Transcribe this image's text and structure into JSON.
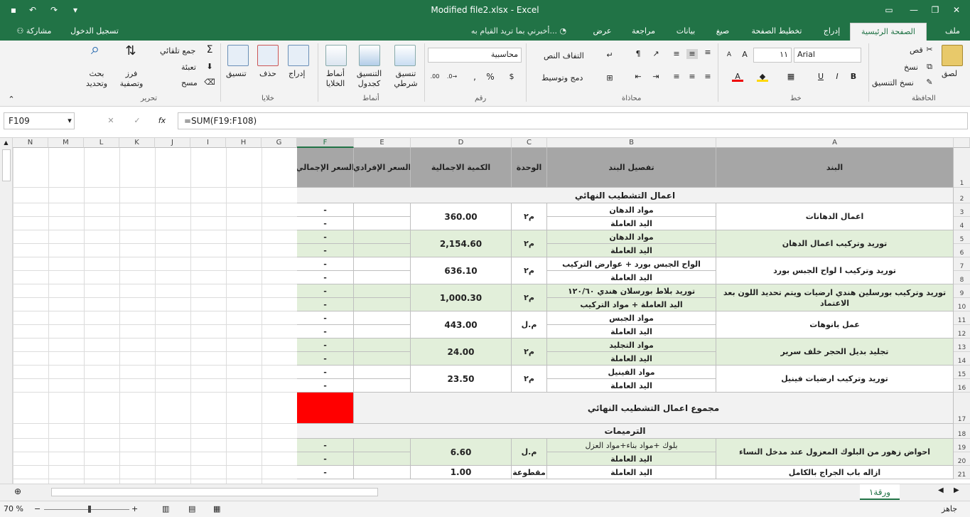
{
  "app": {
    "title": "Modified file2.xlsx - Excel",
    "signin": "تسجيل الدخول",
    "share": "مشاركة",
    "tell_me": "أخبرني بما تريد القيام به..."
  },
  "tabs": [
    "ملف",
    "الصفحة الرئيسية",
    "إدراج",
    "تخطيط الصفحة",
    "صيغ",
    "بيانات",
    "مراجعة",
    "عرض"
  ],
  "ribbon": {
    "clipboard": {
      "label": "الحافظة",
      "paste": "لصق",
      "cut": "قص",
      "copy": "نسخ",
      "format_painter": "نسخ التنسيق"
    },
    "font": {
      "label": "خط",
      "name": "Arial",
      "size": "١١",
      "bold": "B",
      "italic": "I",
      "underline": "U"
    },
    "alignment": {
      "label": "محاذاة",
      "wrap": "التفاف النص",
      "merge": "دمج وتوسيط"
    },
    "number": {
      "label": "رقم",
      "format": "محاسبية",
      "percent": "%",
      "comma": ","
    },
    "styles": {
      "label": "أنماط",
      "conditional": "تنسيق شرطي",
      "as_table": "التنسيق كجدول",
      "cell_styles": "أنماط الخلايا"
    },
    "cells": {
      "label": "خلايا",
      "insert": "إدراج",
      "delete": "حذف",
      "format": "تنسيق"
    },
    "editing": {
      "label": "تحرير",
      "autosum": "جمع تلقائي",
      "fill": "تعبئة",
      "clear": "مسح",
      "sort": "فرز وتصفية",
      "find": "بحث وتحديد"
    }
  },
  "formula_bar": {
    "name_box": "F109",
    "formula": "=SUM(F19:F108)",
    "fx": "fx"
  },
  "columns": [
    "A",
    "B",
    "C",
    "D",
    "E",
    "F",
    "G",
    "H",
    "I",
    "J",
    "K",
    "L",
    "M",
    "N"
  ],
  "rows": [
    "1",
    "2",
    "3",
    "4",
    "5",
    "6",
    "7",
    "8",
    "9",
    "10",
    "11",
    "12",
    "13",
    "14",
    "15",
    "16",
    "17",
    "18",
    "19",
    "20",
    "21"
  ],
  "headers": {
    "item": "البند",
    "detail": "تفصيل البند",
    "unit": "الوحدة",
    "qty": "الكمية الاجمالية",
    "unit_price": "السعر الإفرادي",
    "total": "السعر الإجمالي"
  },
  "sections": {
    "finishing": "اعمال التشطيب النهائي",
    "finishing_total": "مجموع اعمال التشطيب النهائي",
    "renovations": "الترميمات"
  },
  "items": [
    {
      "name": "اعمال الدهانات",
      "d1": "مواد الدهان",
      "d2": "اليد العاملة",
      "unit": "م٢",
      "qty": "360.00"
    },
    {
      "name": "توريد وتركيب  اعمال الدهان",
      "d1": "مواد الدهان",
      "d2": "اليد العاملة",
      "unit": "م٢",
      "qty": "2,154.60"
    },
    {
      "name": "توريد وتركيب  ا لواح  الجبس بورد",
      "d1": "الواح الجبس بورد + عوارض التركيب",
      "d2": "اليد العاملة",
      "unit": "م٢",
      "qty": "636.10"
    },
    {
      "name": "توريد وتركيب بورسلين هندي  ارضيات ويتم تحديد اللون بعد الاعتماد",
      "d1": "توريد بلاط بورسلان هندي ١٢٠/٦٠",
      "d2": "اليد العاملة + مواد التركيب",
      "unit": "م٢",
      "qty": "1,000.30"
    },
    {
      "name": "عمل بانوهات",
      "d1": "مواد الجبس",
      "d2": "اليد العاملة",
      "unit": "م.ل",
      "qty": "443.00"
    },
    {
      "name": "تجليد بديل الحجر خلف سرير",
      "d1": "مواد التجليد",
      "d2": "اليد العاملة",
      "unit": "م٢",
      "qty": "24.00"
    },
    {
      "name": "توريد وتركيب ارضيات فينيل",
      "d1": "مواد الفينيل",
      "d2": "اليد العاملة",
      "unit": "م٢",
      "qty": "23.50"
    }
  ],
  "reno_items": [
    {
      "name": "احواض زهور  من البلوك المعزول عند مدخل النساء",
      "d1": "بلوك +مواد بناء+مواد العزل",
      "d2": "اليد العاملة",
      "unit": "م.ل",
      "qty": "6.60"
    },
    {
      "name": "ازاله  باب الجراج بالكامل",
      "d1": "اليد العاملة",
      "unit": "مقطوعة",
      "qty": "1.00"
    }
  ],
  "dash": "-",
  "sheet_tab": "ورقة١",
  "status": {
    "ready": "جاهز",
    "zoom": "70 %"
  },
  "colors": {
    "brand": "#217346",
    "header_fill": "#a6a6a6",
    "section_fill": "#f2f2f2",
    "alt_fill": "#e2efda",
    "red": "#ff0000"
  }
}
